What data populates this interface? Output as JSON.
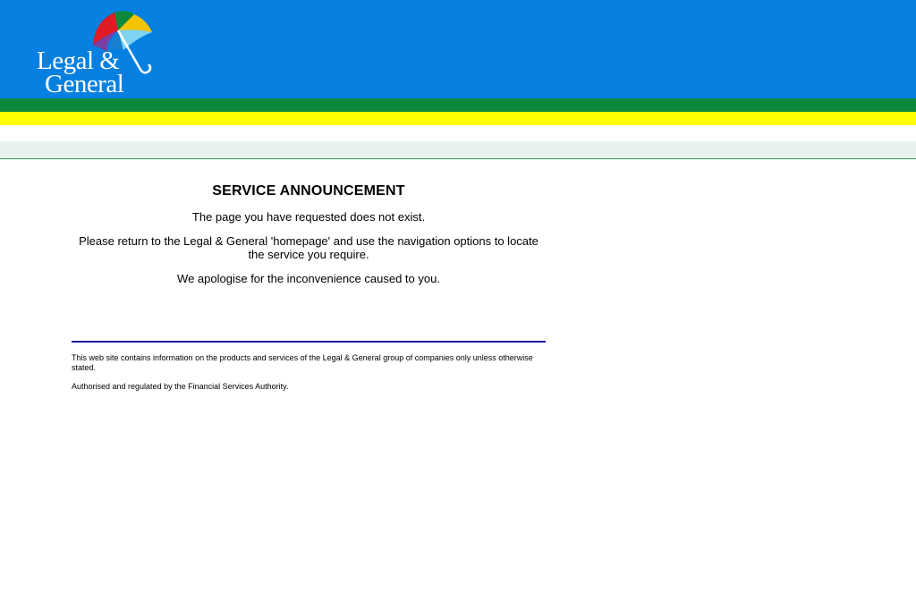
{
  "logo": {
    "line1": "Legal &",
    "line2": "General",
    "icon": "umbrella-icon"
  },
  "announcement": {
    "title": "SERVICE ANNOUNCEMENT",
    "paragraphs": [
      "The page you have requested does not exist.",
      "Please return to the Legal & General 'homepage' and use the navigation options to locate the service you require.",
      "We apologise for the inconvenience caused to you."
    ]
  },
  "footer": {
    "disclaimer": "This web site contains information on the products and services of the Legal & General group of companies only unless otherwise stated.",
    "regulation": "Authorised and regulated by the Financial Services Authority."
  },
  "colors": {
    "header_blue": "#0680e0",
    "band_green": "#0a8a3a",
    "band_yellow": "#ffff00",
    "rule_blue": "#1a1aa0"
  }
}
